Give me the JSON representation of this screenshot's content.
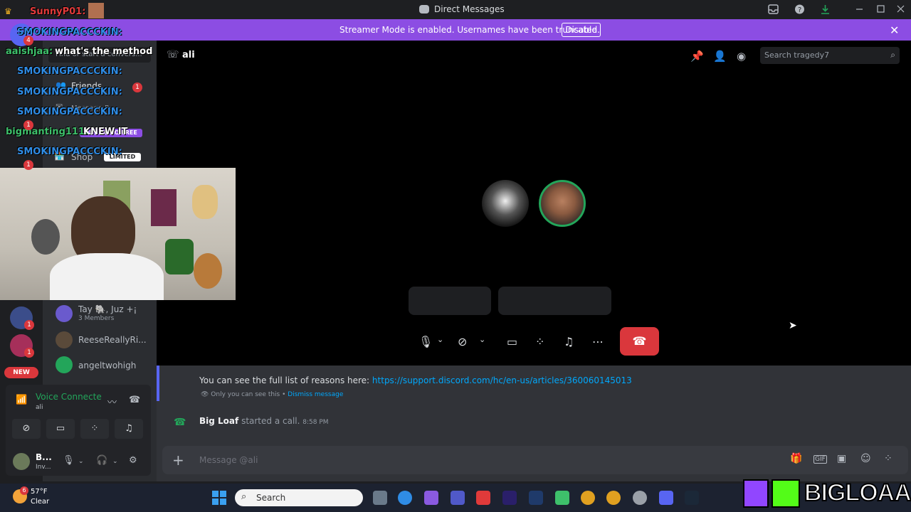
{
  "window": {
    "title": "Direct Messages"
  },
  "banner": {
    "text": "Streamer Mode is enabled. Usernames have been truncated.",
    "button": "Disable"
  },
  "call_header": {
    "name": "ali",
    "search_placeholder": "Search tragedy7"
  },
  "chat": {
    "notice_prefix": "You can see the full list of reasons here: ",
    "notice_link": "https://support.discord.com/hc/en-us/articles/360060145013",
    "only_you": "Only you can see this • ",
    "dismiss": "Dismiss message",
    "call_user": "Big Loaf",
    "call_text": " started a call. ",
    "call_time": "8:58 PM",
    "composer_placeholder": "Message @ali"
  },
  "dm_list": {
    "search_placeholder": "Find or start a convers...",
    "friends": "Friends",
    "message_requests": "Message R...",
    "nitro": "Nitro",
    "shop": "Shop",
    "shop_badge": "LIMITED",
    "free_badge": "GET NITRO FREE",
    "items": [
      {
        "name": "Tay 🐘, Juz +¡",
        "sub": "3 Members"
      },
      {
        "name": "ReeseReallyRi...",
        "sub": ""
      },
      {
        "name": "angeltwohigh",
        "sub": ""
      }
    ]
  },
  "voice_panel": {
    "status": "Voice Connecte",
    "channel": "ali",
    "user": "B...",
    "user_status": "Inv..."
  },
  "rail": {
    "new_badge": "NEW",
    "badges": [
      "4",
      "1",
      "1",
      "1",
      "1",
      "1"
    ]
  },
  "overlay_chat": [
    {
      "user": "SunnyP01:",
      "text": ""
    },
    {
      "user": "SMOKINGPACCCKIN:",
      "text": ""
    },
    {
      "user": "aaishjaa:",
      "text": "what's the method"
    },
    {
      "user": "SMOKINGPACCCKIN:",
      "text": ""
    },
    {
      "user": "SMOKINGPACCCKIN:",
      "text": ""
    },
    {
      "user": "SMOKINGPACCCKIN:",
      "text": ""
    },
    {
      "user": "bigmanting111:",
      "text": "KNEW IT"
    },
    {
      "user": "SMOKINGPACCCKIN:",
      "text": ""
    }
  ],
  "taskbar": {
    "temp": "57°F",
    "condition": "Clear",
    "search_placeholder": "Search",
    "weather_badge": "6"
  },
  "brand": {
    "text": "BIGLOAAF"
  },
  "colors": {
    "accent": "#8c4de3",
    "danger": "#da373c",
    "online": "#23a55a",
    "link": "#00a8fc"
  }
}
